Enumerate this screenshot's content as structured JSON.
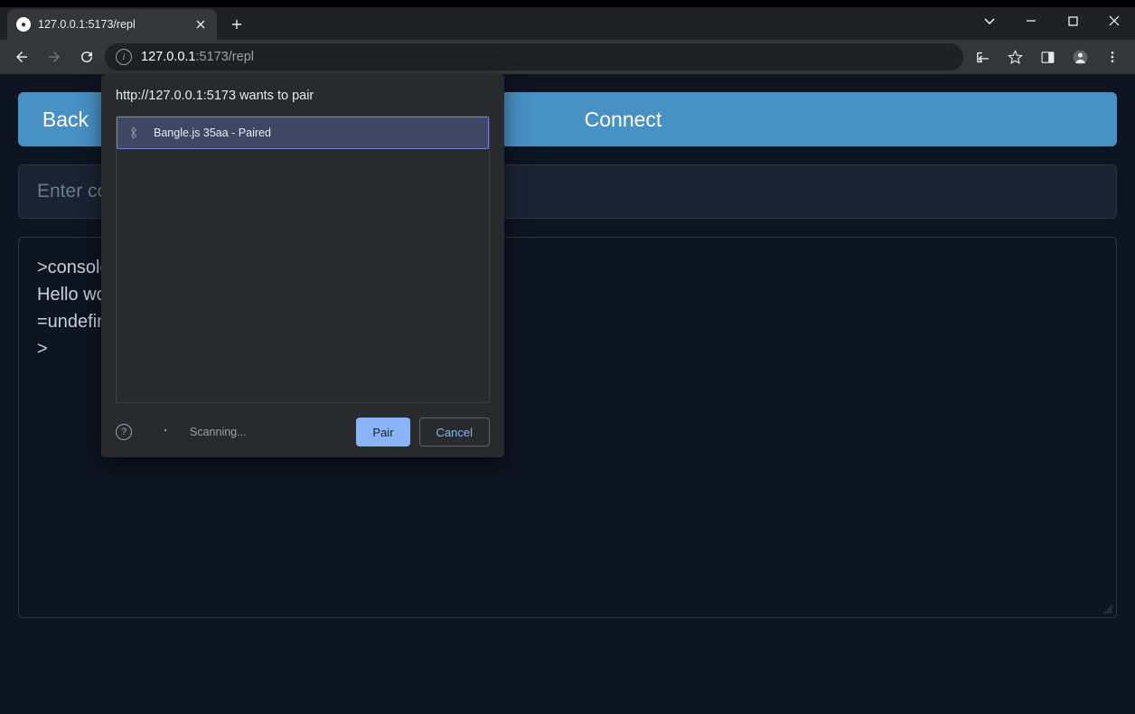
{
  "browser": {
    "tab_title": "127.0.0.1:5173/repl",
    "url_host": "127.0.0.1",
    "url_port_path": ":5173/repl"
  },
  "window_controls": {
    "chevron": "⌄",
    "minimize": "—",
    "maximize": "☐",
    "close": "✕"
  },
  "page": {
    "back_label": "Back",
    "connect_label": "Connect",
    "input_placeholder": "Enter command",
    "console_lines": [
      ">console.log(\"Hello world!\")",
      "Hello world!",
      "=undefined",
      ">"
    ]
  },
  "dialog": {
    "title": "http://127.0.0.1:5173 wants to pair",
    "devices": [
      {
        "name": "Bangle.js 35aa - Paired",
        "selected": true
      }
    ],
    "scanning_label": "Scanning...",
    "pair_label": "Pair",
    "cancel_label": "Cancel"
  }
}
